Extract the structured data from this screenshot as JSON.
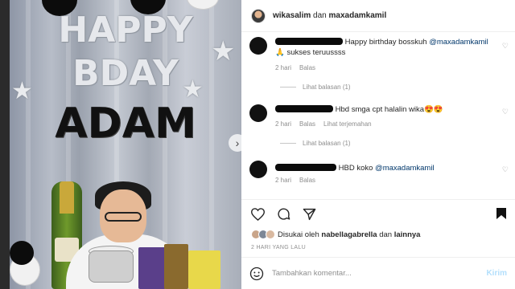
{
  "photo": {
    "balloons_line1": "HAPPY",
    "balloons_line2": "BDAY",
    "balloons_line3": "ADAM"
  },
  "header": {
    "user1": "wikasalim",
    "connector": "dan",
    "user2": "maxadamkamil"
  },
  "comments": [
    {
      "text": "Happy birthday bosskuh ",
      "mention": "@maxadamkamil",
      "line2": "🙏 sukses teruussss",
      "time": "2 hari",
      "reply": "Balas",
      "translate": "",
      "view_replies": "Lihat balasan (1)"
    },
    {
      "text": "Hbd smga cpt halalin wika😍😍",
      "mention": "",
      "line2": "",
      "time": "2 hari",
      "reply": "Balas",
      "translate": "Lihat terjemahan",
      "view_replies": "Lihat balasan (1)"
    },
    {
      "text": "HBD koko ",
      "mention": "@maxadamkamil",
      "line2": "",
      "time": "2 hari",
      "reply": "Balas",
      "translate": "",
      "view_replies": ""
    }
  ],
  "likes": {
    "prefix": "Disukai oleh",
    "user": "nabellagabrella",
    "connector": "dan",
    "others": "lainnya"
  },
  "timestamp": "2 HARI YANG LALU",
  "add_comment": {
    "placeholder": "Tambahkan komentar...",
    "post_label": "Kirim"
  },
  "colors": {
    "link": "#00376b",
    "muted": "#8e8e8e",
    "post_disabled": "#b2dffc"
  }
}
